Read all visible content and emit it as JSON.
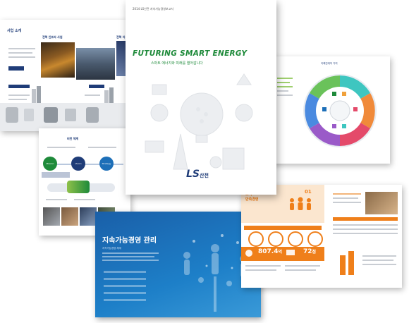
{
  "pages": {
    "business": {
      "title": "사업 소개",
      "section_title": "전력 인프라 사업",
      "section_title_2": "전력 자"
    },
    "vision": {
      "label": "비전 체계",
      "circle_labels": [
        "Mission",
        "Vision",
        "Strategy",
        "Core Value"
      ]
    },
    "cover": {
      "top_text": "2014 LS산전 지속가능경영보고서",
      "headline": "FUTURING SMART ENERGY",
      "tagline": "스마트 에너지와 미래를 열어갑니다",
      "logo_text": "LS",
      "logo_sub": "산전"
    },
    "wheel": {
      "title": "이해관계자 가치"
    },
    "sustain": {
      "title": "지속가능경영 관리",
      "subtitle": "지속가능경영 체계"
    },
    "customer": {
      "title_line1": "고객",
      "title_line2": "만족경영",
      "number": "01",
      "stat1_value": "807.4",
      "stat1_unit": "억",
      "stat2_value": "72",
      "stat2_unit": "점"
    }
  },
  "colors": {
    "navy": "#1f3c78",
    "blue": "#1d6fb8",
    "green": "#1e8a3a",
    "orange": "#ef7f1a",
    "gray": "#9aa1a9"
  }
}
